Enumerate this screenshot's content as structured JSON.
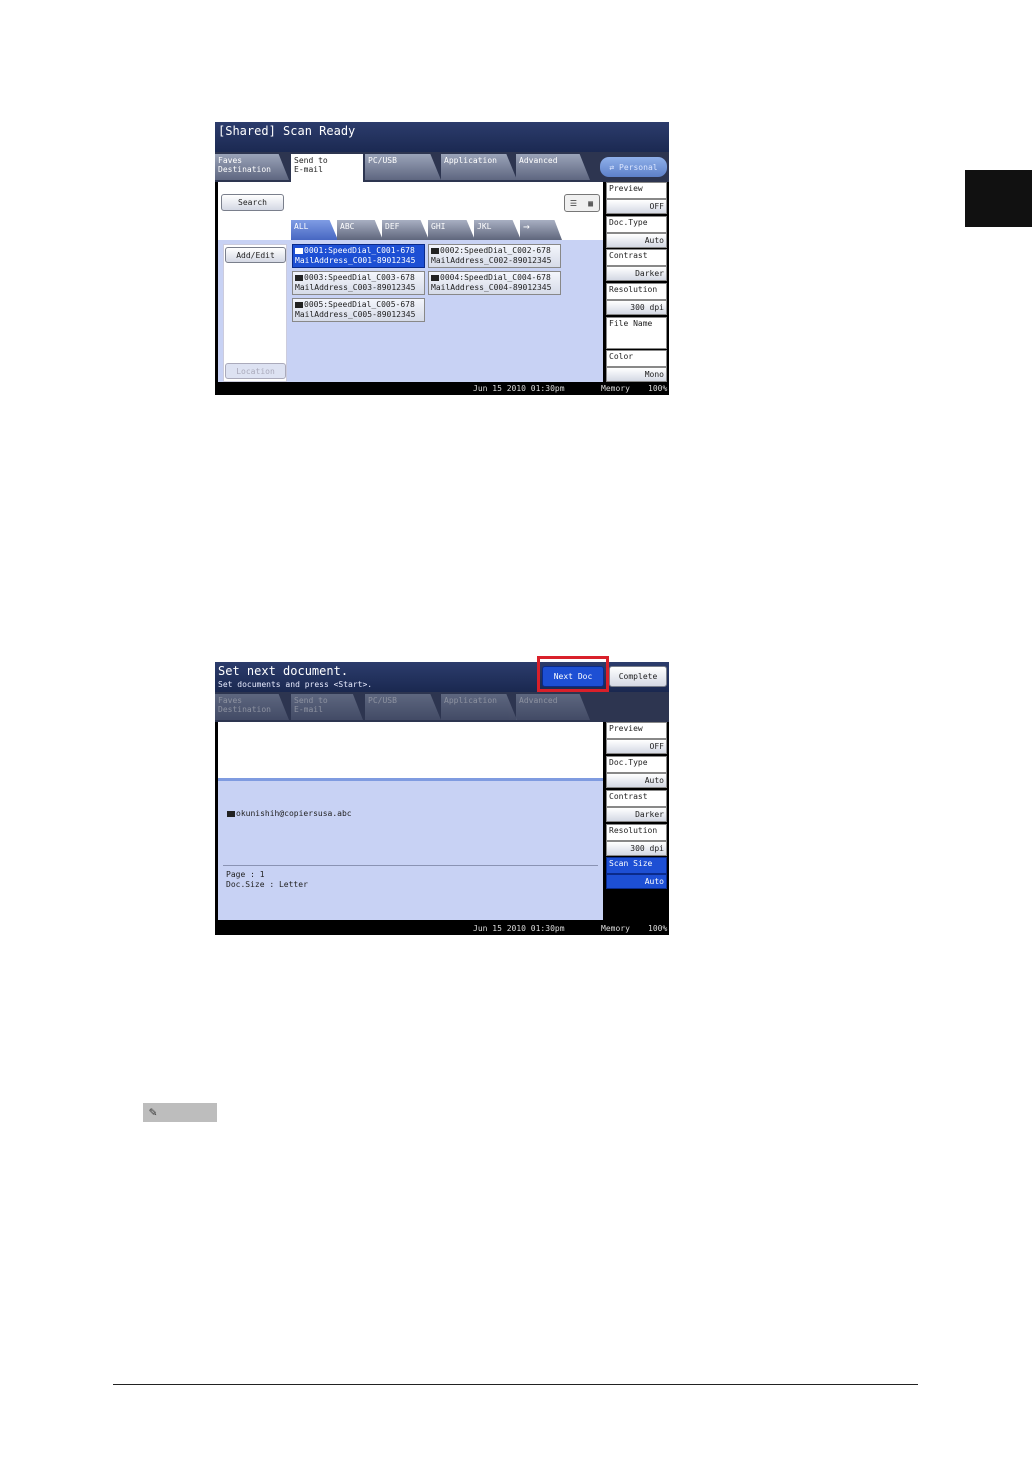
{
  "screen1": {
    "title": "[Shared] Scan Ready",
    "tabs": [
      "Faves\nDestination",
      "Send to\nE-mail",
      "PC/USB",
      "Application",
      "Advanced"
    ],
    "personal_label": "⇄ Personal",
    "search_label": "Search",
    "view_list_icon": "☰",
    "view_grid_icon": "▦",
    "alpha_tabs": [
      "ALL",
      "ABC",
      "DEF",
      "GHI",
      "JKL",
      "→"
    ],
    "add_edit_label": "Add/Edit",
    "location_label": "Location",
    "speed_dials": [
      {
        "line1": "0001:SpeedDial_C001-678",
        "line2": "MailAddress_C001-89012345"
      },
      {
        "line1": "0002:SpeedDial_C002-678",
        "line2": "MailAddress_C002-89012345"
      },
      {
        "line1": "0003:SpeedDial_C003-678",
        "line2": "MailAddress_C003-89012345"
      },
      {
        "line1": "0004:SpeedDial_C004-678",
        "line2": "MailAddress_C004-89012345"
      },
      {
        "line1": "0005:SpeedDial_C005-678",
        "line2": "MailAddress_C005-89012345"
      }
    ],
    "settings": [
      {
        "label": "Preview",
        "value": "OFF"
      },
      {
        "label": "Doc.Type",
        "value": "Auto"
      },
      {
        "label": "Contrast",
        "value": "Darker"
      },
      {
        "label": "Resolution",
        "value": "300 dpi"
      },
      {
        "label": "File Name",
        "value": ""
      },
      {
        "label": "Color",
        "value": "Mono"
      }
    ],
    "status": {
      "date": "Jun 15 2010 01:30pm",
      "memory_label": "Memory",
      "memory_pct": "100%"
    }
  },
  "screen2": {
    "title": "Set next document.",
    "subtitle": "Set documents and press <Start>.",
    "next_doc_label": "Next Doc",
    "complete_label": "Complete",
    "tabs": [
      "Faves\nDestination",
      "Send to\nE-mail",
      "PC/USB",
      "Application",
      "Advanced"
    ],
    "recipient": "okunishih@copiersusa.abc",
    "page_info": "Page : 1",
    "doc_size_info": "Doc.Size : Letter",
    "settings": [
      {
        "label": "Preview",
        "value": "OFF"
      },
      {
        "label": "Doc.Type",
        "value": "Auto"
      },
      {
        "label": "Contrast",
        "value": "Darker"
      },
      {
        "label": "Resolution",
        "value": "300 dpi"
      },
      {
        "label": "Scan Size",
        "value": "Auto"
      }
    ],
    "status": {
      "date": "Jun 15 2010 01:30pm",
      "memory_label": "Memory",
      "memory_pct": "100%"
    }
  },
  "colors": {
    "accent": "#1d4fd4",
    "highlight": "#d9202a",
    "titlebar": "#1a2850",
    "panel": "#c8d2f4"
  }
}
